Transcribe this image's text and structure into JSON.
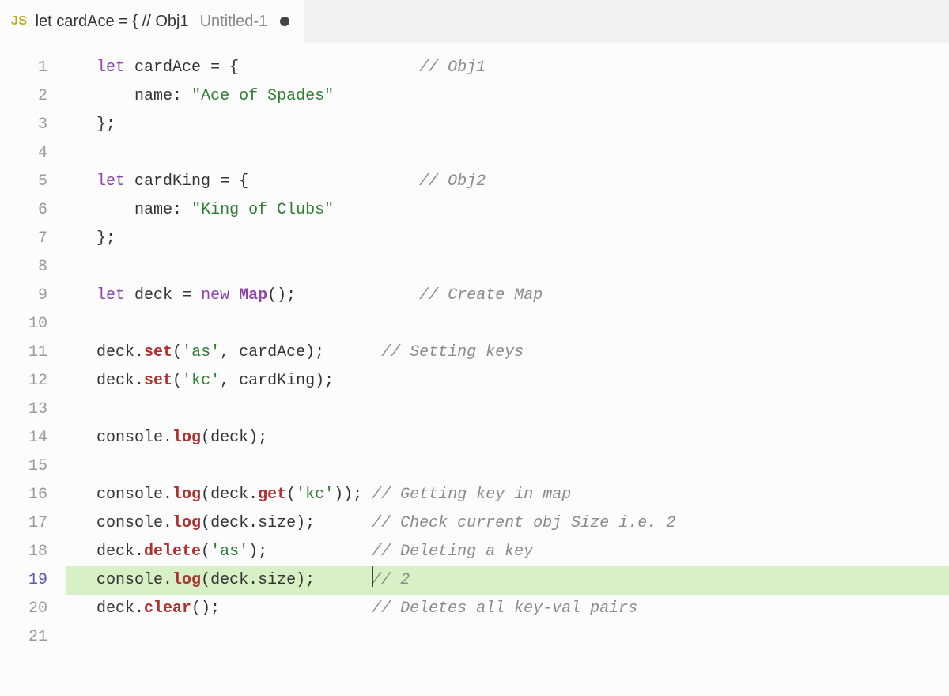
{
  "tab": {
    "lang_badge": "JS",
    "title": "let cardAce = { // Obj1",
    "subtitle": "Untitled-1",
    "dirty": true
  },
  "editor": {
    "active_line": 19,
    "highlighted_line": 19,
    "cursor": {
      "line": 19,
      "before_text": "",
      "after_comment": true
    },
    "lines": [
      {
        "n": 1,
        "tokens": [
          [
            "kw",
            "let"
          ],
          [
            "sp",
            " "
          ],
          [
            "var",
            "cardAce"
          ],
          [
            "sp",
            " "
          ],
          [
            "punc",
            "="
          ],
          [
            "sp",
            " "
          ],
          [
            "punc",
            "{"
          ]
        ],
        "comment_col": 34,
        "comment": "// Obj1"
      },
      {
        "n": 2,
        "indent": 1,
        "guide": true,
        "tokens": [
          [
            "prop",
            "name"
          ],
          [
            "punc",
            ":"
          ],
          [
            "sp",
            " "
          ],
          [
            "str",
            "\"Ace of Spades\""
          ]
        ]
      },
      {
        "n": 3,
        "tokens": [
          [
            "punc",
            "};"
          ]
        ]
      },
      {
        "n": 4,
        "tokens": []
      },
      {
        "n": 5,
        "tokens": [
          [
            "kw",
            "let"
          ],
          [
            "sp",
            " "
          ],
          [
            "var",
            "cardKing"
          ],
          [
            "sp",
            " "
          ],
          [
            "punc",
            "="
          ],
          [
            "sp",
            " "
          ],
          [
            "punc",
            "{"
          ]
        ],
        "comment_col": 34,
        "comment": "// Obj2"
      },
      {
        "n": 6,
        "indent": 1,
        "guide": true,
        "tokens": [
          [
            "prop",
            "name"
          ],
          [
            "punc",
            ":"
          ],
          [
            "sp",
            " "
          ],
          [
            "str",
            "\"King of Clubs\""
          ]
        ]
      },
      {
        "n": 7,
        "tokens": [
          [
            "punc",
            "};"
          ]
        ]
      },
      {
        "n": 8,
        "tokens": []
      },
      {
        "n": 9,
        "tokens": [
          [
            "kw",
            "let"
          ],
          [
            "sp",
            " "
          ],
          [
            "var",
            "deck"
          ],
          [
            "sp",
            " "
          ],
          [
            "punc",
            "="
          ],
          [
            "sp",
            " "
          ],
          [
            "kw",
            "new"
          ],
          [
            "sp",
            " "
          ],
          [
            "cls",
            "Map"
          ],
          [
            "punc",
            "();"
          ]
        ],
        "comment_col": 34,
        "comment": "// Create Map"
      },
      {
        "n": 10,
        "tokens": []
      },
      {
        "n": 11,
        "tokens": [
          [
            "var",
            "deck"
          ],
          [
            "punc",
            "."
          ],
          [
            "fn",
            "set"
          ],
          [
            "punc",
            "("
          ],
          [
            "str",
            "'as'"
          ],
          [
            "punc",
            ","
          ],
          [
            "sp",
            " "
          ],
          [
            "var",
            "cardAce"
          ],
          [
            "punc",
            ");"
          ]
        ],
        "comment_col": 30,
        "comment": "// Setting keys"
      },
      {
        "n": 12,
        "tokens": [
          [
            "var",
            "deck"
          ],
          [
            "punc",
            "."
          ],
          [
            "fn",
            "set"
          ],
          [
            "punc",
            "("
          ],
          [
            "str",
            "'kc'"
          ],
          [
            "punc",
            ","
          ],
          [
            "sp",
            " "
          ],
          [
            "var",
            "cardKing"
          ],
          [
            "punc",
            ");"
          ]
        ]
      },
      {
        "n": 13,
        "tokens": []
      },
      {
        "n": 14,
        "tokens": [
          [
            "var",
            "console"
          ],
          [
            "punc",
            "."
          ],
          [
            "fn",
            "log"
          ],
          [
            "punc",
            "("
          ],
          [
            "var",
            "deck"
          ],
          [
            "punc",
            ");"
          ]
        ]
      },
      {
        "n": 15,
        "tokens": []
      },
      {
        "n": 16,
        "tokens": [
          [
            "var",
            "console"
          ],
          [
            "punc",
            "."
          ],
          [
            "fn",
            "log"
          ],
          [
            "punc",
            "("
          ],
          [
            "var",
            "deck"
          ],
          [
            "punc",
            "."
          ],
          [
            "fn",
            "get"
          ],
          [
            "punc",
            "("
          ],
          [
            "str",
            "'kc'"
          ],
          [
            "punc",
            "));"
          ]
        ],
        "comment_col": 24,
        "comment": "// Getting key in map"
      },
      {
        "n": 17,
        "tokens": [
          [
            "var",
            "console"
          ],
          [
            "punc",
            "."
          ],
          [
            "fn",
            "log"
          ],
          [
            "punc",
            "("
          ],
          [
            "var",
            "deck"
          ],
          [
            "punc",
            "."
          ],
          [
            "prop",
            "size"
          ],
          [
            "punc",
            ");"
          ]
        ],
        "comment_col": 29,
        "comment": "// Check current obj Size i.e. 2"
      },
      {
        "n": 18,
        "tokens": [
          [
            "var",
            "deck"
          ],
          [
            "punc",
            "."
          ],
          [
            "fn",
            "delete"
          ],
          [
            "punc",
            "("
          ],
          [
            "str",
            "'as'"
          ],
          [
            "punc",
            ");"
          ]
        ],
        "comment_col": 29,
        "comment": "// Deleting a key"
      },
      {
        "n": 19,
        "tokens": [
          [
            "var",
            "console"
          ],
          [
            "punc",
            "."
          ],
          [
            "fn",
            "log"
          ],
          [
            "punc",
            "("
          ],
          [
            "var",
            "deck"
          ],
          [
            "punc",
            "."
          ],
          [
            "prop",
            "size"
          ],
          [
            "punc",
            ");"
          ]
        ],
        "comment_col": 29,
        "comment": "// 2",
        "cursor_at_comment": true
      },
      {
        "n": 20,
        "tokens": [
          [
            "var",
            "deck"
          ],
          [
            "punc",
            "."
          ],
          [
            "fn",
            "clear"
          ],
          [
            "punc",
            "();"
          ]
        ],
        "comment_col": 29,
        "comment": "// Deletes all key-val pairs"
      },
      {
        "n": 21,
        "tokens": []
      }
    ]
  }
}
